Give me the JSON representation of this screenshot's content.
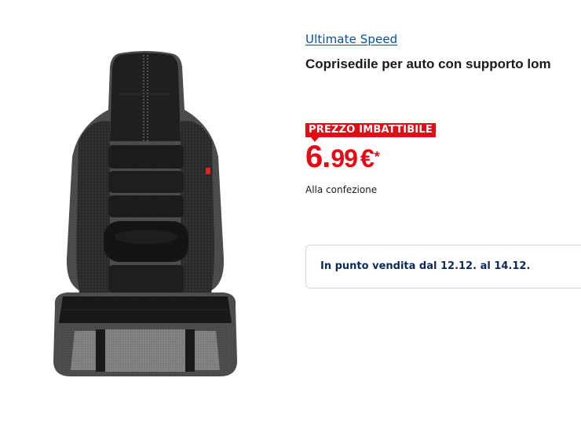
{
  "product": {
    "brand": "Ultimate Speed",
    "title": "Coprisedile per auto con supporto lom",
    "image_alt": "car-seat-cover-image"
  },
  "pricing": {
    "badge": "PREZZO IMBATTIBILE",
    "price_integer": "6",
    "price_separator": ".",
    "price_decimal": "99",
    "currency": "€",
    "footnote_mark": "*",
    "unit_note": "Alla confezione"
  },
  "availability": {
    "text": "In punto vendita dal 12.12. al 14.12."
  },
  "colors": {
    "brand_link": "#0050aa",
    "price_red": "#e60a14",
    "availability_text": "#0b2a5b"
  }
}
